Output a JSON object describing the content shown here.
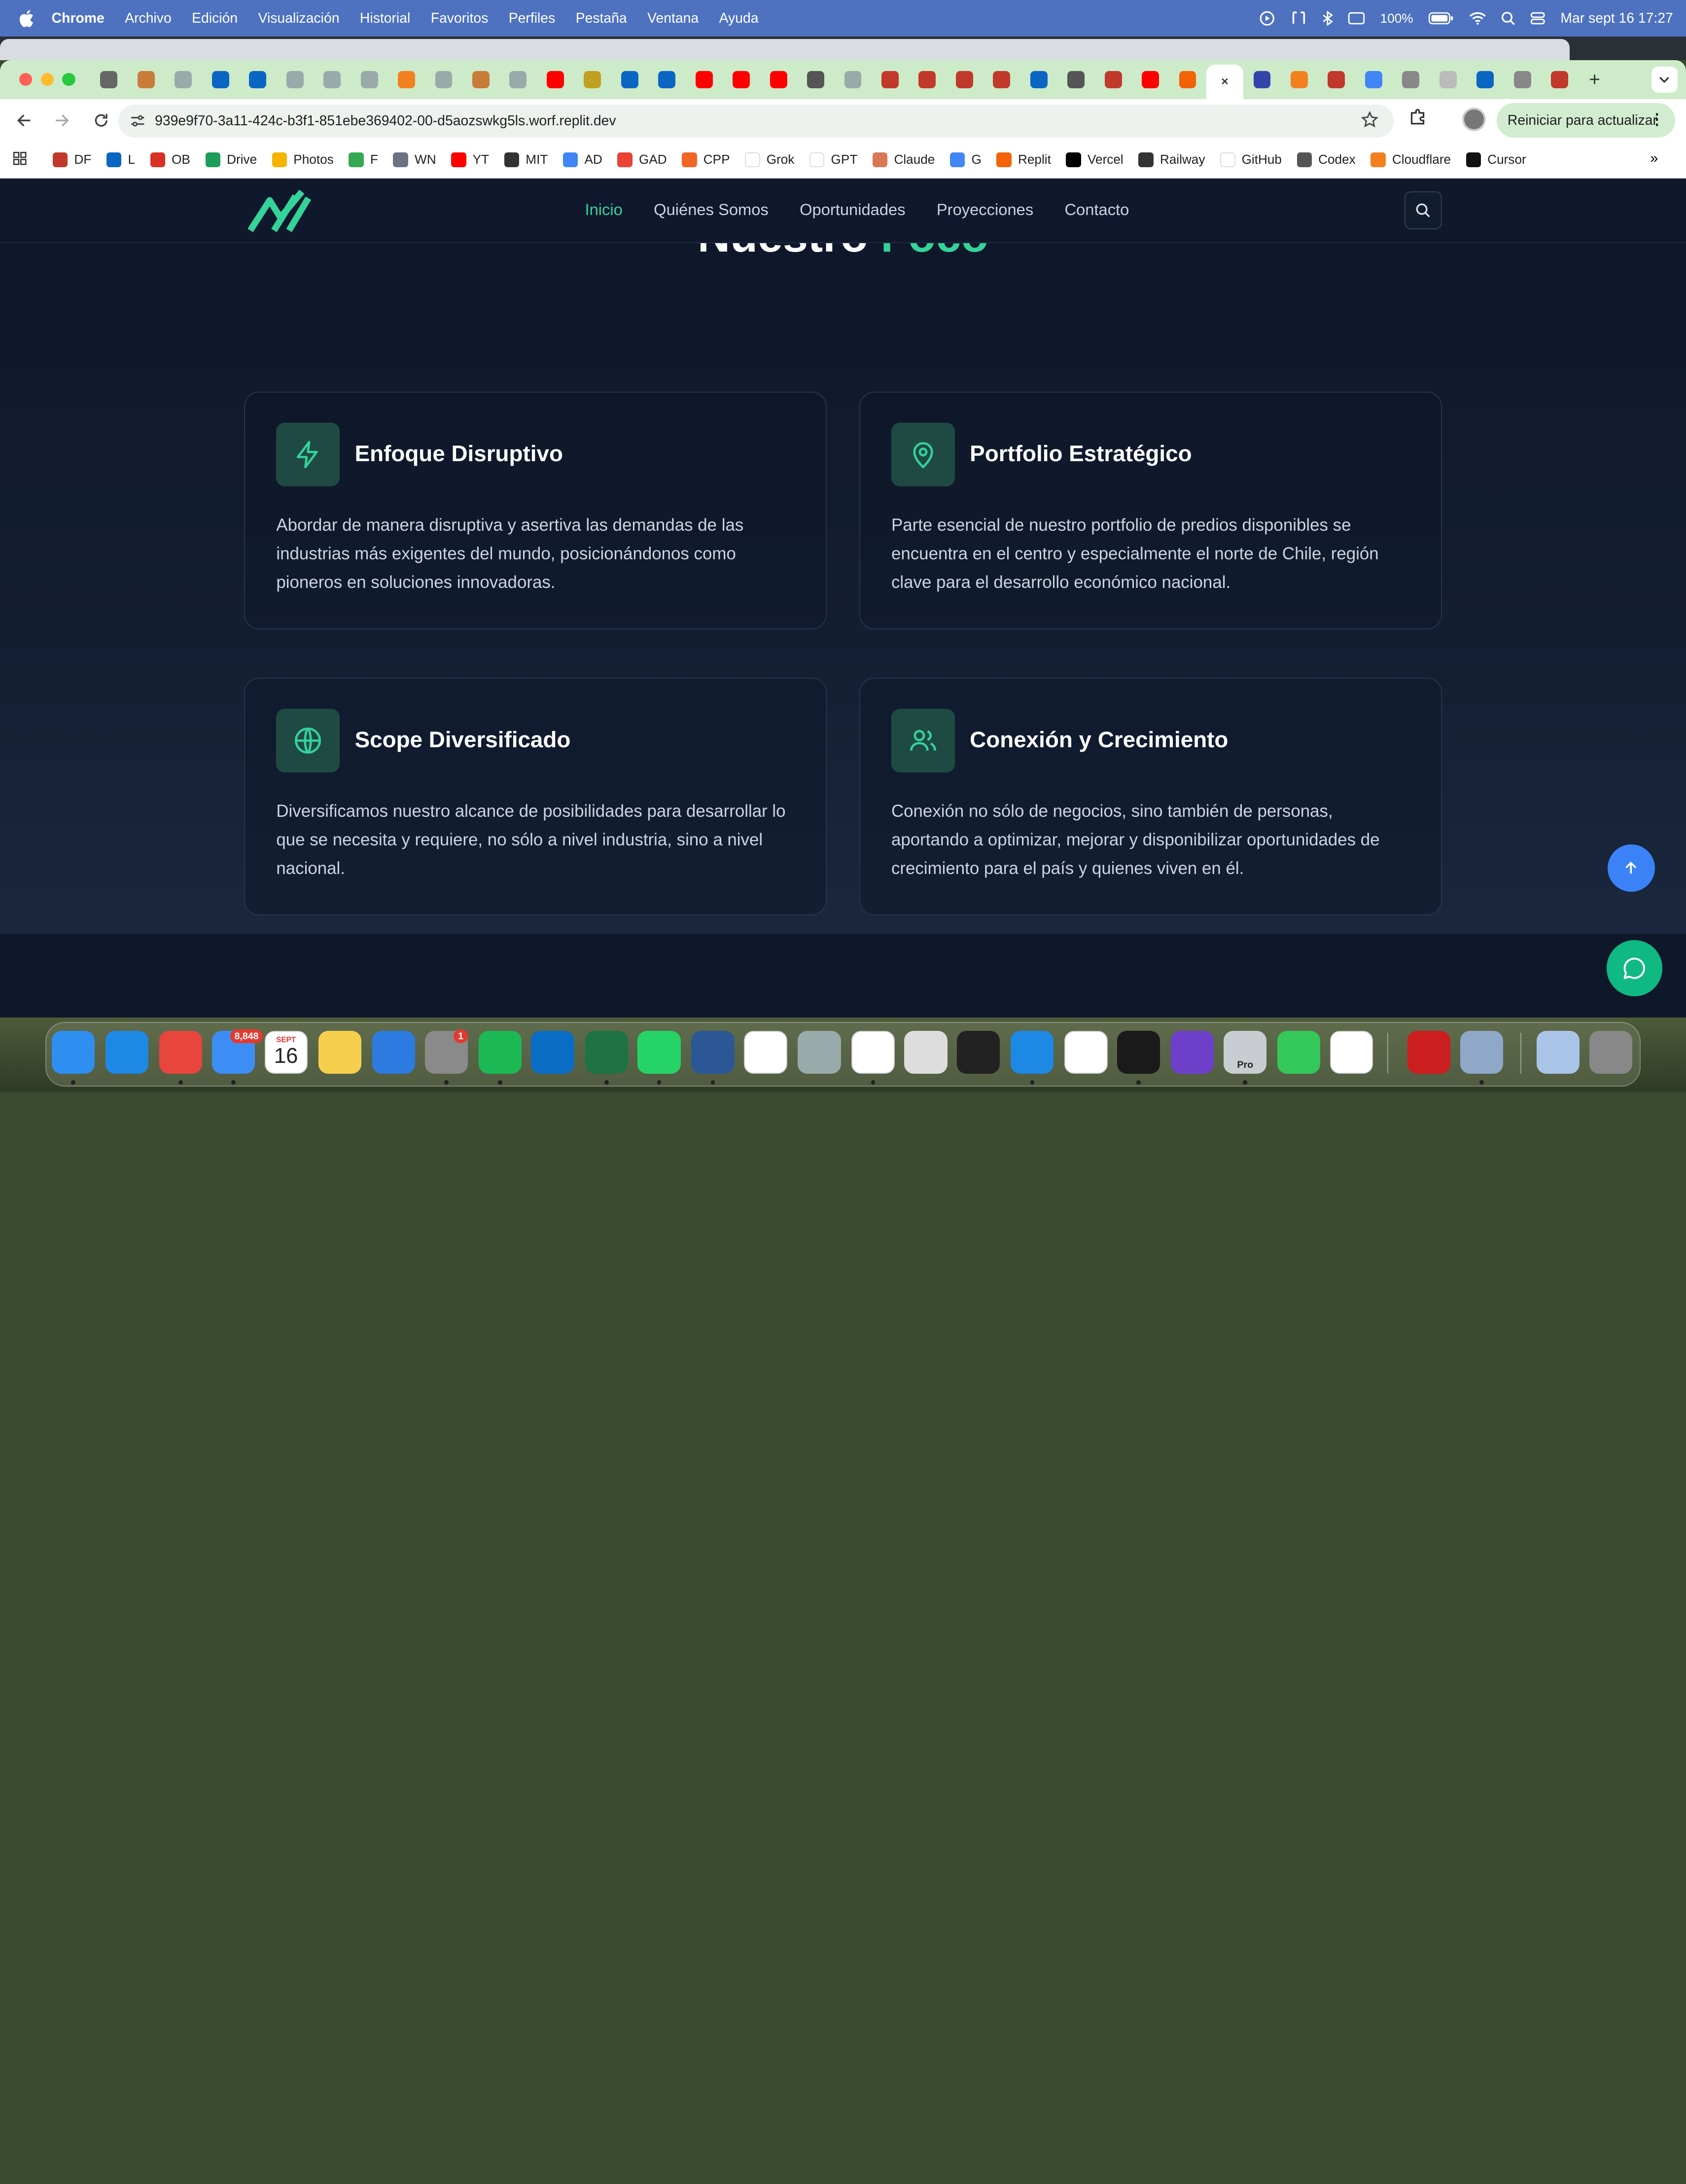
{
  "menubar": {
    "app_name": "Chrome",
    "items": [
      "Archivo",
      "Edición",
      "Visualización",
      "Historial",
      "Favoritos",
      "Perfiles",
      "Pestaña",
      "Ventana",
      "Ayuda"
    ],
    "battery": "100%",
    "clock": "Mar sept 16  17:27"
  },
  "browser": {
    "url": "939e9f70-3a11-424c-b3f1-851ebe369402-00-d5aozswkg5ls.worf.replit.dev",
    "relaunch_label": "Reiniciar para actualizar",
    "new_tab": "+",
    "close_tab": "✕",
    "bookmarks": [
      {
        "label": "DF",
        "color": "#c0392b"
      },
      {
        "label": "L",
        "color": "#0a66c2"
      },
      {
        "label": "OB",
        "color": "#d93025"
      },
      {
        "label": "Drive",
        "color": "#1a9c5b"
      },
      {
        "label": "Photos",
        "color": "#f4b400"
      },
      {
        "label": "F",
        "color": "#34a853"
      },
      {
        "label": "WN",
        "color": "#6b7280"
      },
      {
        "label": "YT",
        "color": "#ff0000"
      },
      {
        "label": "MIT",
        "color": "#333333"
      },
      {
        "label": "AD",
        "color": "#4285f4"
      },
      {
        "label": "GAD",
        "color": "#ea4335"
      },
      {
        "label": "CPP",
        "color": "#f26522"
      },
      {
        "label": "Grok",
        "color": "#ffffff"
      },
      {
        "label": "GPT",
        "color": "#ffffff"
      },
      {
        "label": "Claude",
        "color": "#d97757"
      },
      {
        "label": "G",
        "color": "#4285f4"
      },
      {
        "label": "Replit",
        "color": "#f26207"
      },
      {
        "label": "Vercel",
        "color": "#000000"
      },
      {
        "label": "Railway",
        "color": "#333333"
      },
      {
        "label": "GitHub",
        "color": "#ffffff"
      },
      {
        "label": "Codex",
        "color": "#555555"
      },
      {
        "label": "Cloudflare",
        "color": "#f38020"
      },
      {
        "label": "Cursor",
        "color": "#111111"
      }
    ],
    "more": "»"
  },
  "site": {
    "nav": [
      "Inicio",
      "Quiénes Somos",
      "Oportunidades",
      "Proyecciones",
      "Contacto"
    ],
    "heading_plain": "Nuestro",
    "heading_accent": "Foco",
    "cards": [
      {
        "icon": "zap-icon",
        "title": "Enfoque Disruptivo",
        "text": "Abordar de manera disruptiva y asertiva las demandas de las industrias más exigentes del mundo, posicionándonos como pioneros en soluciones innovadoras."
      },
      {
        "icon": "map-pin-icon",
        "title": "Portfolio Estratégico",
        "text": "Parte esencial de nuestro portfolio de predios disponibles se encuentra en el centro y especialmente el norte de Chile, región clave para el desarrollo económico nacional."
      },
      {
        "icon": "globe-icon",
        "title": "Scope Diversificado",
        "text": "Diversificamos nuestro alcance de posibilidades para desarrollar lo que se necesita y requiere, no sólo a nivel industria, sino a nivel nacional."
      },
      {
        "icon": "users-icon",
        "title": "Conexión y Crecimiento",
        "text": "Conexión no sólo de negocios, sino también de personas, aportando a optimizar, mejorar y disponibilizar oportunidades de crecimiento para el país y quienes viven en él."
      }
    ],
    "accent_color": "#34d399"
  },
  "dock": {
    "mail_badge": "8,848",
    "calendar_month": "SEPT",
    "calendar_day": "16",
    "settings_badge": "1",
    "pro_label": "Pro"
  }
}
